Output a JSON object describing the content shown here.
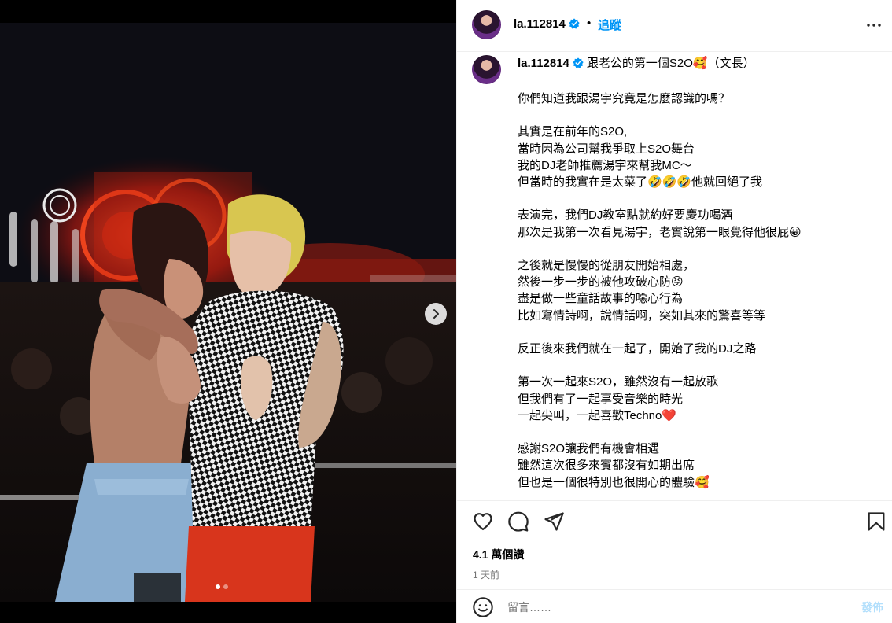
{
  "post": {
    "username": "la.112814",
    "follow_label": "追蹤",
    "separator": "•",
    "caption_title": "跟老公的第一個S2O🥰（文長）",
    "caption_body": "你們知道我跟湯宇究竟是怎麼認識的嗎？\n\n其實是在前年的S2O,\n當時因為公司幫我爭取上S2O舞台\n我的DJ老師推薦湯宇來幫我MC～\n但當時的我實在是太菜了🤣🤣🤣他就回絕了我\n\n表演完，我們DJ教室點就約好要慶功喝酒\n那次是我第一次看見湯宇，老實說第一眼覺得他很屁😀\n\n之後就是慢慢的從朋友開始相處，\n然後一步一步的被他攻破心防😝\n盡是做一些童話故事的噁心行為\n比如寫情詩啊，說情話啊，突如其來的驚喜等等\n\n反正後來我們就在一起了，開始了我的DJ之路\n\n第一次一起來S2O，雖然沒有一起放歌\n但我們有了一起享受音樂的時光\n一起尖叫，一起喜歡Techno❤️\n\n感謝S2O讓我們有機會相遇\n雖然這次很多來賓都沒有如期出席\n但也是一個很特別也很開心的體驗🥰",
    "likes": "4.1 萬個讚",
    "time_ago": "1 天前",
    "comment_placeholder": "留言……",
    "post_label": "發佈",
    "carousel": {
      "total": 2,
      "current": 1
    }
  },
  "icons": {
    "verified": "verified-badge-icon",
    "more": "more-options-icon",
    "like": "heart-icon",
    "comment": "comment-bubble-icon",
    "share": "paper-plane-icon",
    "save": "bookmark-icon",
    "emoji": "emoji-icon",
    "next": "chevron-right-icon"
  },
  "colors": {
    "accent": "#0095f6",
    "verified": "#0095f6",
    "muted": "#737373",
    "post_disabled": "#b2dffc"
  }
}
